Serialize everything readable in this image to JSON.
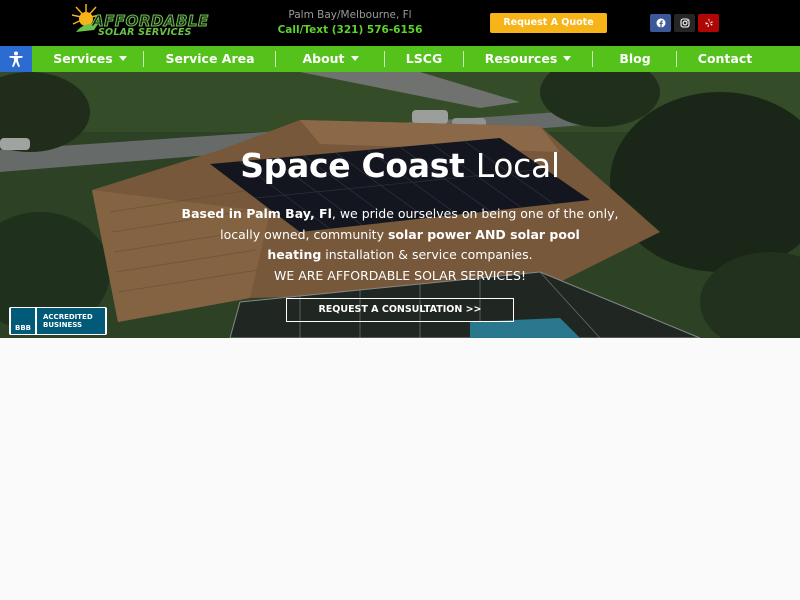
{
  "header": {
    "logo": {
      "line1": "AFFORDABLE",
      "line2": "SOLAR SERVICES"
    },
    "location": "Palm Bay/Melbourne, Fl",
    "phone": "Call/Text (321) 576-6156",
    "quote_button": "Request A Quote",
    "social": [
      "facebook-icon",
      "instagram-icon",
      "yelp-icon"
    ]
  },
  "nav": {
    "items": [
      {
        "label": "Services",
        "dropdown": true
      },
      {
        "label": "Service Area",
        "dropdown": false
      },
      {
        "label": "About",
        "dropdown": true
      },
      {
        "label": "LSCG",
        "dropdown": false
      },
      {
        "label": "Resources",
        "dropdown": true
      },
      {
        "label": "Blog",
        "dropdown": false
      },
      {
        "label": "Contact",
        "dropdown": false
      }
    ]
  },
  "hero": {
    "title_bold": "Space Coast",
    "title_light": "Local",
    "p1_bold": "Based in Palm Bay, Fl",
    "p1_rest": ", we pride ourselves on being one of the only,",
    "p2_start": "locally owned, community ",
    "p2_bold": "solar power AND solar pool",
    "p3_bold": "heating",
    "p3_rest": " installation & service companies.",
    "p4": "WE ARE AFFORDABLE SOLAR SERVICES!",
    "cta": "REQUEST A CONSULTATION >>"
  },
  "badge": {
    "logo": "BBB",
    "line1": "ACCREDITED",
    "line2": "BUSINESS"
  },
  "colors": {
    "nav_green": "#55c11b",
    "quote_orange": "#f6b418",
    "phone_green": "#5fd12f",
    "access_blue": "#2c6bd0"
  }
}
